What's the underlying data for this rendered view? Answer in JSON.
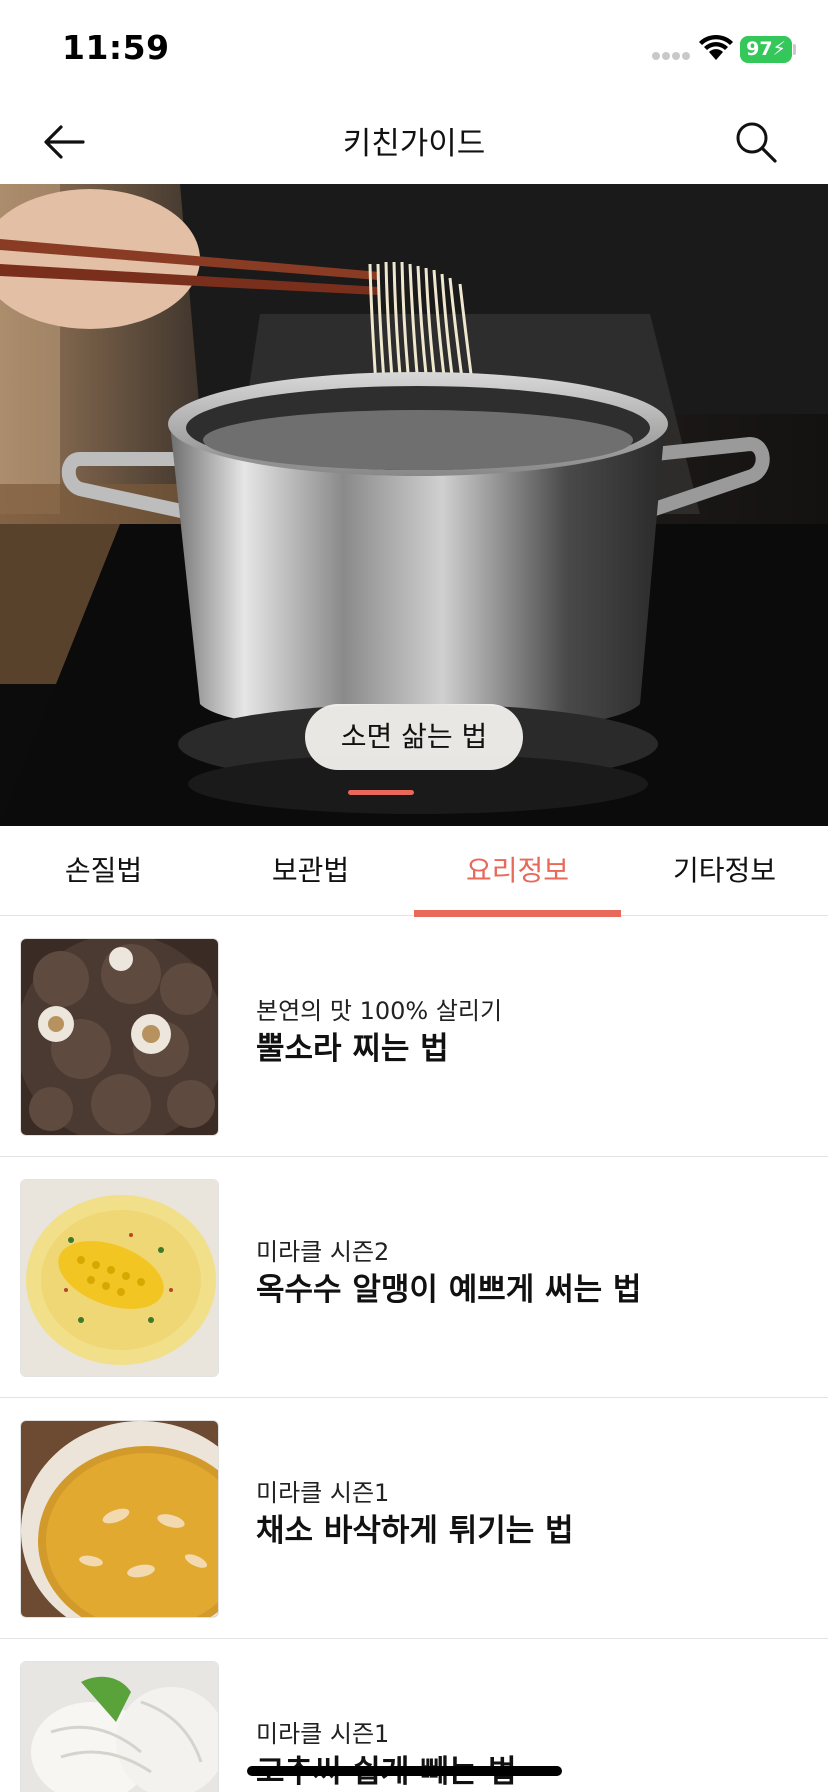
{
  "status_bar": {
    "time": "11:59",
    "battery": "97",
    "icons": [
      "signal-icon",
      "wifi-icon",
      "battery-icon"
    ]
  },
  "header": {
    "title": "키친가이드",
    "back_icon": "arrow-left-icon",
    "search_icon": "search-icon"
  },
  "hero": {
    "label": "소면 삶는 법",
    "active_slide": 1
  },
  "tabs": [
    {
      "label": "손질법",
      "active": false
    },
    {
      "label": "보관법",
      "active": false
    },
    {
      "label": "요리정보",
      "active": true
    },
    {
      "label": "기타정보",
      "active": false
    }
  ],
  "list": [
    {
      "subtitle": "본연의 맛 100% 살리기",
      "title": "뿔소라 찌는 법",
      "thumbnail": "sea-snail-photo"
    },
    {
      "subtitle": "미라클 시즌2",
      "title": "옥수수 알맹이 예쁘게 써는 법",
      "thumbnail": "corn-soup-photo"
    },
    {
      "subtitle": "미라클 시즌1",
      "title": "채소 바삭하게 튀기는 법",
      "thumbnail": "frying-oil-photo"
    },
    {
      "subtitle": "미라클 시즌1",
      "title": "고추씨 쉽게 빼는 법",
      "thumbnail": "gloved-hands-photo"
    }
  ],
  "colors": {
    "accent": "#e8685a",
    "battery": "#34c759",
    "divider": "#e3e3e3"
  }
}
